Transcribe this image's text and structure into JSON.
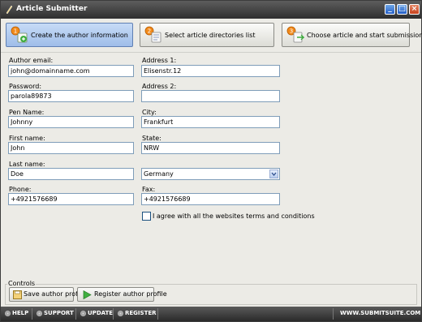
{
  "window": {
    "title": "Article Submitter",
    "minimize_symbol": "_",
    "maximize_symbol": "□",
    "close_symbol": "×"
  },
  "steps": [
    {
      "number": "1",
      "label": "Create the author information",
      "active": true
    },
    {
      "number": "2",
      "label": "Select article directories list",
      "active": false
    },
    {
      "number": "3",
      "label": "Choose article and start submission",
      "active": false
    }
  ],
  "form": {
    "email_label": "Author email:",
    "email_value": "john@domainname.com",
    "password_label": "Password:",
    "password_value": "parola89873",
    "penname_label": "Pen Name:",
    "penname_value": "Johnny",
    "firstname_label": "First name:",
    "firstname_value": "John",
    "lastname_label": "Last name:",
    "lastname_value": "Doe",
    "phone_label": "Phone:",
    "phone_value": "+4921576689",
    "address1_label": "Address 1:",
    "address1_value": "Elisenstr.12",
    "address2_label": "Address 2:",
    "address2_value": "",
    "city_label": "City:",
    "city_value": "Frankfurt",
    "state_label": "State:",
    "state_value": "NRW",
    "country_value": "Germany",
    "fax_label": "Fax:",
    "fax_value": "+4921576689",
    "agree_label": "I agree with all the websites terms and conditions",
    "agree_checked": false
  },
  "controls": {
    "legend": "Controls",
    "save_label": "Save author profile",
    "register_label": "Register author profile"
  },
  "footer": {
    "help": "HELP",
    "support": "SUPPORT",
    "update": "UPDATE",
    "register": "REGISTER",
    "brand": "WWW.SUBMITSUITE.COM"
  },
  "colors": {
    "titlebar": "#3c3c3c",
    "active_step": "#9fbde9",
    "window_bg": "#ecebe6",
    "input_border": "#7f9db9"
  }
}
